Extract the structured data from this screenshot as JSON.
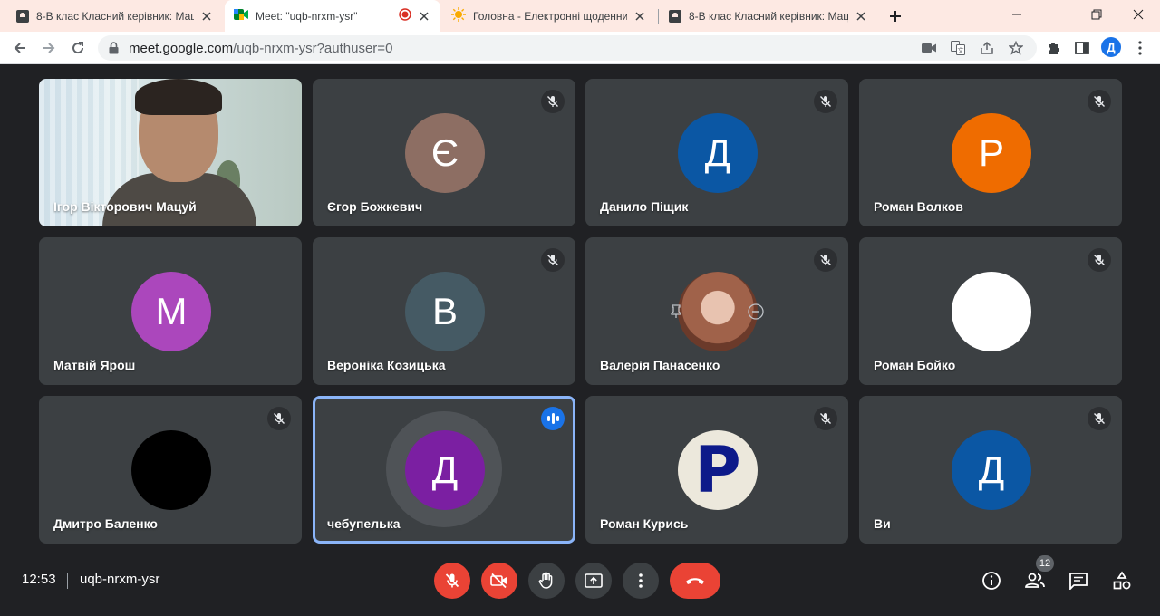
{
  "browser": {
    "tabs": [
      {
        "title": "8-В клас Класний керівник: Мацу",
        "favicon": "slides-icon",
        "active": false
      },
      {
        "title": "Meet: \"uqb-nrxm-ysr\"",
        "favicon": "meet-icon",
        "active": true,
        "recording": true
      },
      {
        "title": "Головна - Електронні щоденник",
        "favicon": "sun-icon",
        "active": false
      },
      {
        "title": "8-В клас Класний керівник: Мацу",
        "favicon": "slides-icon",
        "active": false
      }
    ],
    "url_host": "meet.google.com",
    "url_path": "/uqb-nrxm-ysr?authuser=0",
    "profile_initial": "Д"
  },
  "participants": [
    {
      "name": "Ігор Вікторович Мацуй",
      "type": "video",
      "muted": false
    },
    {
      "name": "Єгор Божкевич",
      "initial": "Є",
      "color": "#8d6e63",
      "muted": true
    },
    {
      "name": "Данило Піщик",
      "initial": "Д",
      "color": "#0b57a4",
      "muted": true
    },
    {
      "name": "Роман Волков",
      "initial": "Р",
      "color": "#ef6c00",
      "muted": true
    },
    {
      "name": "Матвій Ярош",
      "initial": "М",
      "color": "#ab47bc",
      "muted": true
    },
    {
      "name": "Вероніка Козицька",
      "initial": "В",
      "color": "#455a64",
      "muted": true
    },
    {
      "name": "Валерія Панасенко",
      "type": "photo",
      "muted": true
    },
    {
      "name": "Роман Бойко",
      "initial": "",
      "color": "#ffffff",
      "muted": true
    },
    {
      "name": "Дмитро Баленко",
      "initial": "",
      "color": "#000000",
      "muted": true
    },
    {
      "name": "чебупелька",
      "initial": "Д",
      "color": "#7b1fa2",
      "speaking": true
    },
    {
      "name": "Роман Курись",
      "initial": "P",
      "color": "#ece8dc",
      "muted": true
    },
    {
      "name": "Ви",
      "initial": "Д",
      "color": "#0b57a4",
      "muted": true
    }
  ],
  "bottom_bar": {
    "time": "12:53",
    "meeting_code": "uqb-nrxm-ysr",
    "participant_count": "12"
  },
  "colors": {
    "meet_bg": "#202124",
    "tile_bg": "#3c4043",
    "control_red": "#ea4335",
    "speaking_border": "#8ab4f8",
    "tabstrip": "#fde9e3"
  }
}
